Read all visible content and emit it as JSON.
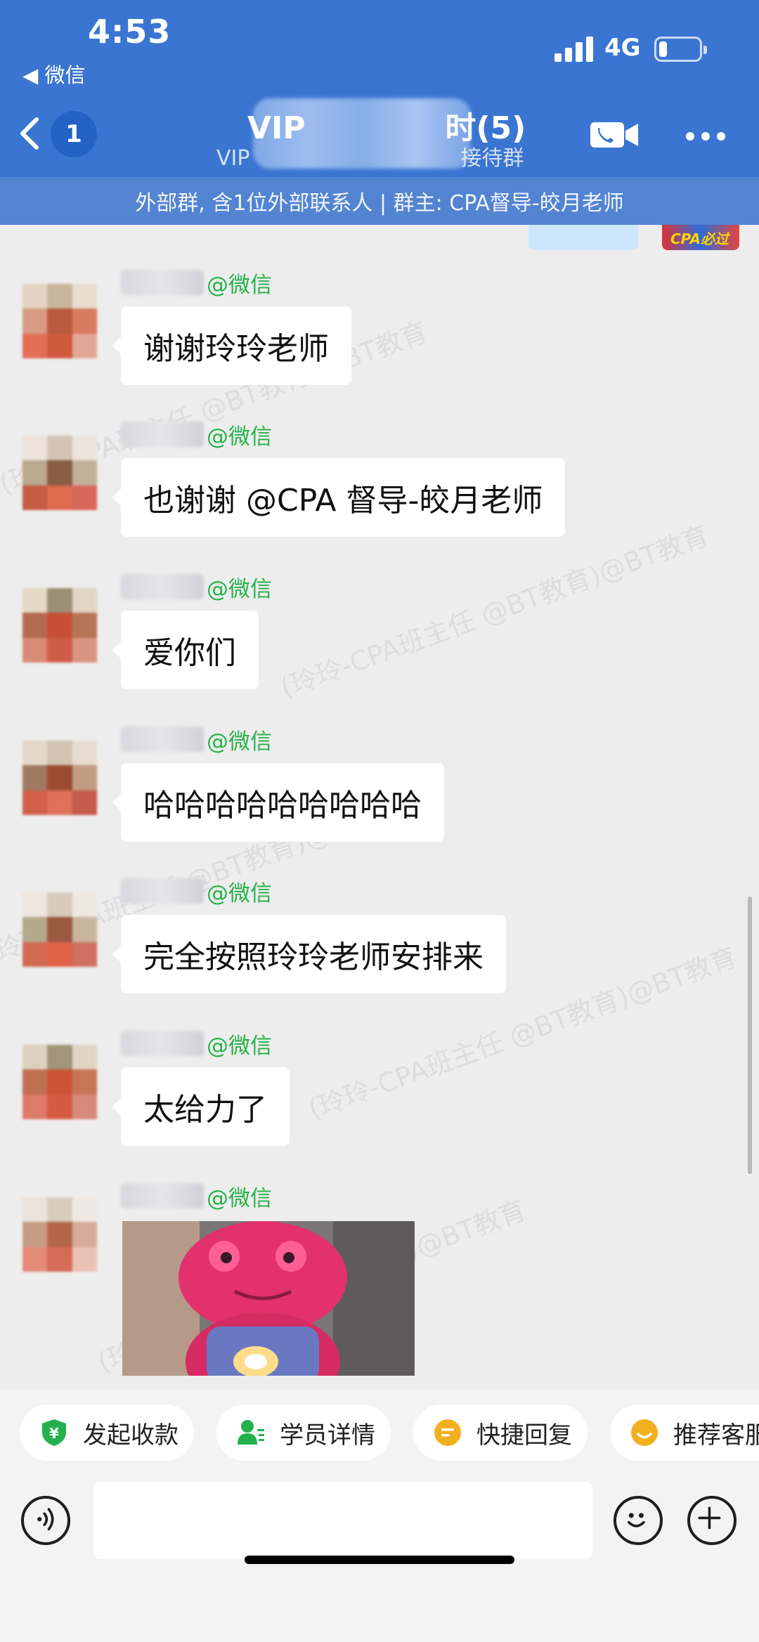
{
  "status_bar": {
    "time": "4:53",
    "back_app": "◀ 微信",
    "network": "4G",
    "battery_level": 0.2
  },
  "nav": {
    "unread_count": "1",
    "title_prefix": "VIP",
    "title_suffix": "时(5)",
    "subtitle_prefix": "VIP",
    "subtitle_suffix": "接待群"
  },
  "notice": "外部群, 含1位外部联系人 | 群主: CPA督导-皎月老师",
  "watermark_text": "(玲玲-CPA班主任 @BT教育)@BT教育",
  "messages": [
    {
      "sender_tag": "@微信",
      "text": "谢谢玲玲老师",
      "avatar_colors": [
        "#e4d3c2",
        "#c9b59c",
        "#eadcce",
        "#d89a82",
        "#b85a3e",
        "#d77b60",
        "#e06f55",
        "#cf5a3e",
        "#e2a696"
      ]
    },
    {
      "sender_tag": "@微信",
      "text": "也谢谢 @CPA 督导-皎月老师",
      "avatar_colors": [
        "#ece2da",
        "#d5c4b5",
        "#ece4dc",
        "#b9a98d",
        "#8a5e43",
        "#c4b09a",
        "#c55c43",
        "#df6a4c",
        "#d8685a"
      ]
    },
    {
      "sender_tag": "@微信",
      "text": "爱你们",
      "avatar_colors": [
        "#e5d8c4",
        "#9c8f74",
        "#e3d5c4",
        "#b46a52",
        "#c84e36",
        "#b87458",
        "#d98a76",
        "#cf5d45",
        "#d99580"
      ]
    },
    {
      "sender_tag": "@微信",
      "text": "哈哈哈哈哈哈哈哈哈",
      "avatar_colors": [
        "#e6d7c8",
        "#d2c3b2",
        "#e8dccf",
        "#a17a62",
        "#9c4a30",
        "#c39a82",
        "#d16049",
        "#e0715a",
        "#c75c4c"
      ]
    },
    {
      "sender_tag": "@微信",
      "text": "完全按照玲玲老师安排来",
      "avatar_colors": [
        "#ece6de",
        "#d8cbbd",
        "#efe8e0",
        "#b4a98a",
        "#9b5a40",
        "#c9b59e",
        "#d26a54",
        "#e06248",
        "#cf7062"
      ]
    },
    {
      "sender_tag": "@微信",
      "text": "太给力了",
      "avatar_colors": [
        "#ddd0bf",
        "#a39579",
        "#e1d4c3",
        "#c06f52",
        "#cc5336",
        "#c47657",
        "#de7a68",
        "#d55a41",
        "#d88a7a"
      ]
    },
    {
      "sender_tag": "@微信",
      "text": "",
      "avatar_colors": [
        "#ebe3dc",
        "#d8ccbf",
        "#efe8e2",
        "#c79e85",
        "#b56549",
        "#d6ab98",
        "#e38a78",
        "#d66b57",
        "#e9c2b5"
      ]
    }
  ],
  "quick_actions": [
    {
      "label": "发起收款",
      "icon": "payment-icon"
    },
    {
      "label": "学员详情",
      "icon": "student-detail-icon"
    },
    {
      "label": "快捷回复",
      "icon": "quick-reply-icon"
    },
    {
      "label": "推荐客服",
      "icon": "recommend-service-icon"
    }
  ],
  "input": {
    "placeholder": ""
  }
}
